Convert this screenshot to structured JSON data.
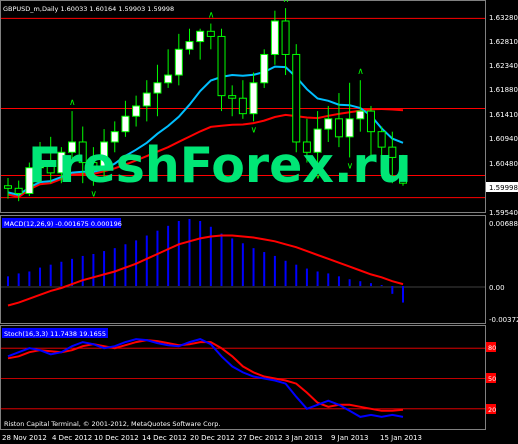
{
  "window": {
    "header": "GBPUSD_m,Daily  1.60033  1.60164  1.59903  1.59998",
    "watermark": "FreshForex.ru",
    "copyright": "Riston Capital Terminal, © 2001-2012, MetaQuotes Software Corp."
  },
  "price_panel": {
    "axis_labels": [
      "1.63280",
      "1.62810",
      "1.62340",
      "1.61880",
      "1.61410",
      "1.60940",
      "1.60480",
      "1.59998",
      "1.59540"
    ],
    "current_price": "1.59998"
  },
  "macd_panel": {
    "title": "MACD(12,26,9) -0.001675 0.000196",
    "axis_labels": [
      "0.006888",
      "0.00",
      "-0.003727"
    ]
  },
  "stoch_panel": {
    "title": "Stoch(16,3,3) 11.7438 19.1655",
    "axis_labels": [
      "80",
      "50",
      "20"
    ]
  },
  "time_axis": [
    "28 Nov 2012",
    "4 Dec 2012",
    "10 Dec 2012",
    "14 Dec 2012",
    "20 Dec 2012",
    "27 Dec 2012",
    "3 Jan 2013",
    "9 Jan 2013",
    "15 Jan 2013"
  ],
  "colors": {
    "background": "#000000",
    "bull_candle": "#ffffff",
    "bear_candle": "#000000",
    "wick": "#00ff00",
    "level_lines": "#ff0000",
    "ma_fast": "#00bfff",
    "ma_slow": "#ff0000",
    "macd_histogram": "#0000ff",
    "signal_line": "#ff0000",
    "stoch_main": "#0000ff",
    "watermark": "#00e676"
  },
  "chart_data": [
    {
      "type": "candlestick",
      "title": "GBPUSD_m,Daily",
      "x": [
        "26 Nov",
        "27 Nov",
        "28 Nov",
        "29 Nov",
        "30 Nov",
        "3 Dec",
        "4 Dec",
        "5 Dec",
        "6 Dec",
        "7 Dec",
        "10 Dec",
        "11 Dec",
        "12 Dec",
        "13 Dec",
        "14 Dec",
        "17 Dec",
        "18 Dec",
        "19 Dec",
        "20 Dec",
        "21 Dec",
        "24 Dec",
        "26 Dec",
        "27 Dec",
        "28 Dec",
        "31 Dec",
        "2 Jan",
        "3 Jan",
        "4 Jan",
        "7 Jan",
        "8 Jan",
        "9 Jan",
        "10 Jan",
        "11 Jan",
        "14 Jan",
        "15 Jan",
        "16 Jan",
        "17 Jan",
        "18 Jan"
      ],
      "open": [
        1.5995,
        1.599,
        1.598,
        1.603,
        1.604,
        1.602,
        1.606,
        1.608,
        1.604,
        1.603,
        1.608,
        1.61,
        1.613,
        1.615,
        1.6175,
        1.6195,
        1.621,
        1.626,
        1.6275,
        1.6295,
        1.6285,
        1.617,
        1.6165,
        1.6135,
        1.6195,
        1.625,
        1.6315,
        1.625,
        1.608,
        1.606,
        1.6105,
        1.6125,
        1.609,
        1.6125,
        1.614,
        1.61,
        1.607,
        1.605
      ],
      "high": [
        1.601,
        1.6005,
        1.604,
        1.608,
        1.609,
        1.607,
        1.614,
        1.611,
        1.607,
        1.6105,
        1.612,
        1.616,
        1.617,
        1.62,
        1.623,
        1.626,
        1.629,
        1.63,
        1.63,
        1.631,
        1.63,
        1.619,
        1.62,
        1.6215,
        1.626,
        1.6335,
        1.634,
        1.627,
        1.6125,
        1.614,
        1.615,
        1.6175,
        1.6195,
        1.62,
        1.615,
        1.611,
        1.61,
        1.6055
      ],
      "low": [
        1.597,
        1.5965,
        1.5975,
        1.601,
        1.6,
        1.6,
        1.604,
        1.6,
        1.5995,
        1.601,
        1.606,
        1.609,
        1.611,
        1.612,
        1.613,
        1.6185,
        1.619,
        1.625,
        1.624,
        1.626,
        1.614,
        1.613,
        1.6125,
        1.612,
        1.6185,
        1.623,
        1.621,
        1.606,
        1.604,
        1.603,
        1.608,
        1.607,
        1.605,
        1.61,
        1.605,
        1.603,
        1.6,
        1.5995
      ],
      "close": [
        1.599,
        1.598,
        1.603,
        1.604,
        1.602,
        1.606,
        1.608,
        1.604,
        1.603,
        1.608,
        1.61,
        1.613,
        1.615,
        1.6175,
        1.6195,
        1.621,
        1.626,
        1.6275,
        1.6295,
        1.6285,
        1.617,
        1.6165,
        1.6135,
        1.6195,
        1.625,
        1.6315,
        1.625,
        1.608,
        1.606,
        1.6105,
        1.6125,
        1.609,
        1.6125,
        1.614,
        1.61,
        1.607,
        1.605,
        1.6
      ],
      "level_lines": [
        1.632,
        1.6145,
        1.6015,
        1.5972
      ],
      "ylim": [
        1.5944,
        1.6348
      ]
    },
    {
      "type": "line",
      "title": "MACD(12,26,9) -0.001675 0.000196",
      "series": [
        {
          "values": [
            0.001,
            0.0013,
            0.0015,
            0.0019,
            0.0022,
            0.0025,
            0.0028,
            0.0031,
            0.0033,
            0.0036,
            0.0039,
            0.0043,
            0.0047,
            0.0052,
            0.0057,
            0.0062,
            0.0067,
            0.0069,
            0.0067,
            0.0061,
            0.0054,
            0.0049,
            0.0044,
            0.0039,
            0.0035,
            0.0031,
            0.0026,
            0.0022,
            0.0018,
            0.0015,
            0.0013,
            0.001,
            0.0007,
            0.0005,
            0.0003,
            0.0001,
            -0.0008,
            -0.0017
          ]
        },
        {
          "values": [
            -0.002,
            -0.0017,
            -0.0013,
            -0.0009,
            -0.0005,
            -0.0002,
            0.0002,
            0.0006,
            0.0009,
            0.0012,
            0.0015,
            0.0019,
            0.0023,
            0.0028,
            0.0033,
            0.0038,
            0.0043,
            0.0046,
            0.0049,
            0.0051,
            0.0052,
            0.0052,
            0.0051,
            0.005,
            0.0048,
            0.0046,
            0.0043,
            0.004,
            0.0036,
            0.0032,
            0.0028,
            0.0024,
            0.002,
            0.0016,
            0.0012,
            0.0009,
            0.0005,
            0.0002
          ]
        }
      ],
      "ylim": [
        -0.0037,
        0.0069
      ]
    },
    {
      "type": "line",
      "title": "Stoch(16,3,3) 11.7438 19.1655",
      "series": [
        {
          "values": [
            72,
            76,
            80,
            78,
            74,
            76,
            82,
            86,
            84,
            80,
            82,
            86,
            89,
            88,
            85,
            83,
            82,
            86,
            89,
            84,
            72,
            62,
            56,
            52,
            50,
            48,
            45,
            32,
            20,
            24,
            28,
            24,
            18,
            12,
            14,
            12,
            14,
            12
          ]
        },
        {
          "values": [
            70,
            72,
            76,
            78,
            77,
            76,
            78,
            82,
            84,
            82,
            80,
            83,
            86,
            88,
            87,
            85,
            83,
            84,
            86,
            86,
            80,
            72,
            62,
            56,
            52,
            50,
            48,
            45,
            36,
            26,
            22,
            24,
            24,
            22,
            20,
            18,
            18,
            19
          ]
        }
      ],
      "ylim": [
        0,
        100
      ],
      "levels": [
        80,
        50,
        20
      ]
    }
  ]
}
